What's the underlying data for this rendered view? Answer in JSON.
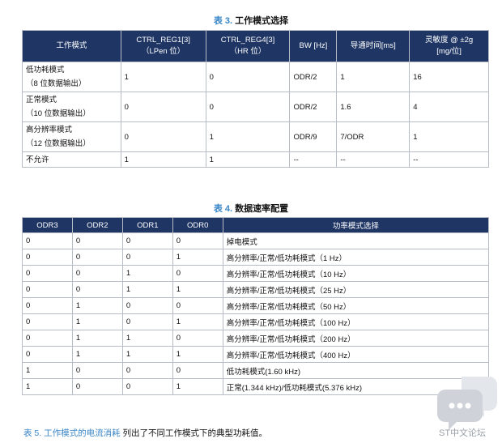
{
  "table3": {
    "caption_num": "表 3.",
    "caption_title": "工作模式选择",
    "headers": [
      {
        "line1": "工作模式",
        "line2": ""
      },
      {
        "line1": "CTRL_REG1[3]",
        "line2": "（LPen 位）"
      },
      {
        "line1": "CTRL_REG4[3]",
        "line2": "（HR 位）"
      },
      {
        "line1": "BW [Hz]",
        "line2": ""
      },
      {
        "line1": "导通时间[ms]",
        "line2": ""
      },
      {
        "line1": "灵敏度 @ ±2g",
        "line2": "[mg/位]"
      }
    ],
    "rows": [
      {
        "mode": "低功耗模式",
        "mode_sub": "（8 位数据输出）",
        "lpen": "1",
        "hr": "0",
        "bw": "ODR/2",
        "ton": "1",
        "sens": "16"
      },
      {
        "mode": "正常模式",
        "mode_sub": "（10 位数据输出）",
        "lpen": "0",
        "hr": "0",
        "bw": "ODR/2",
        "ton": "1.6",
        "sens": "4"
      },
      {
        "mode": "高分辨率模式",
        "mode_sub": "（12 位数据输出）",
        "lpen": "0",
        "hr": "1",
        "bw": "ODR/9",
        "ton": "7/ODR",
        "sens": "1"
      },
      {
        "mode": "不允许",
        "mode_sub": "",
        "lpen": "1",
        "hr": "1",
        "bw": "--",
        "ton": "--",
        "sens": "--"
      }
    ]
  },
  "table4": {
    "caption_num": "表 4.",
    "caption_title": "数据速率配置",
    "headers": [
      "ODR3",
      "ODR2",
      "ODR1",
      "ODR0",
      "功率模式选择"
    ],
    "rows": [
      [
        "0",
        "0",
        "0",
        "0",
        "掉电模式"
      ],
      [
        "0",
        "0",
        "0",
        "1",
        "高分辨率/正常/低功耗模式（1 Hz）"
      ],
      [
        "0",
        "0",
        "1",
        "0",
        "高分辨率/正常/低功耗模式（10 Hz）"
      ],
      [
        "0",
        "0",
        "1",
        "1",
        "高分辨率/正常/低功耗模式（25 Hz）"
      ],
      [
        "0",
        "1",
        "0",
        "0",
        "高分辨率/正常/低功耗模式（50 Hz）"
      ],
      [
        "0",
        "1",
        "0",
        "1",
        "高分辨率/正常/低功耗模式（100 Hz）"
      ],
      [
        "0",
        "1",
        "1",
        "0",
        "高分辨率/正常/低功耗模式（200 Hz）"
      ],
      [
        "0",
        "1",
        "1",
        "1",
        "高分辨率/正常/低功耗模式（400 Hz）"
      ],
      [
        "1",
        "0",
        "0",
        "0",
        "低功耗模式(1.60 kHz)"
      ],
      [
        "1",
        "0",
        "0",
        "1",
        "正常(1.344 kHz)/低功耗模式(5.376 kHz)"
      ]
    ]
  },
  "footer": {
    "link_text": "表 5. 工作模式的电流消耗",
    "rest_text": " 列出了不同工作模式下的典型功耗值。"
  },
  "watermark": {
    "text": "ST中文论坛"
  },
  "colors": {
    "header_bg": "#1f3665",
    "caption_num": "#3a86c6",
    "link": "#3a86c6"
  }
}
